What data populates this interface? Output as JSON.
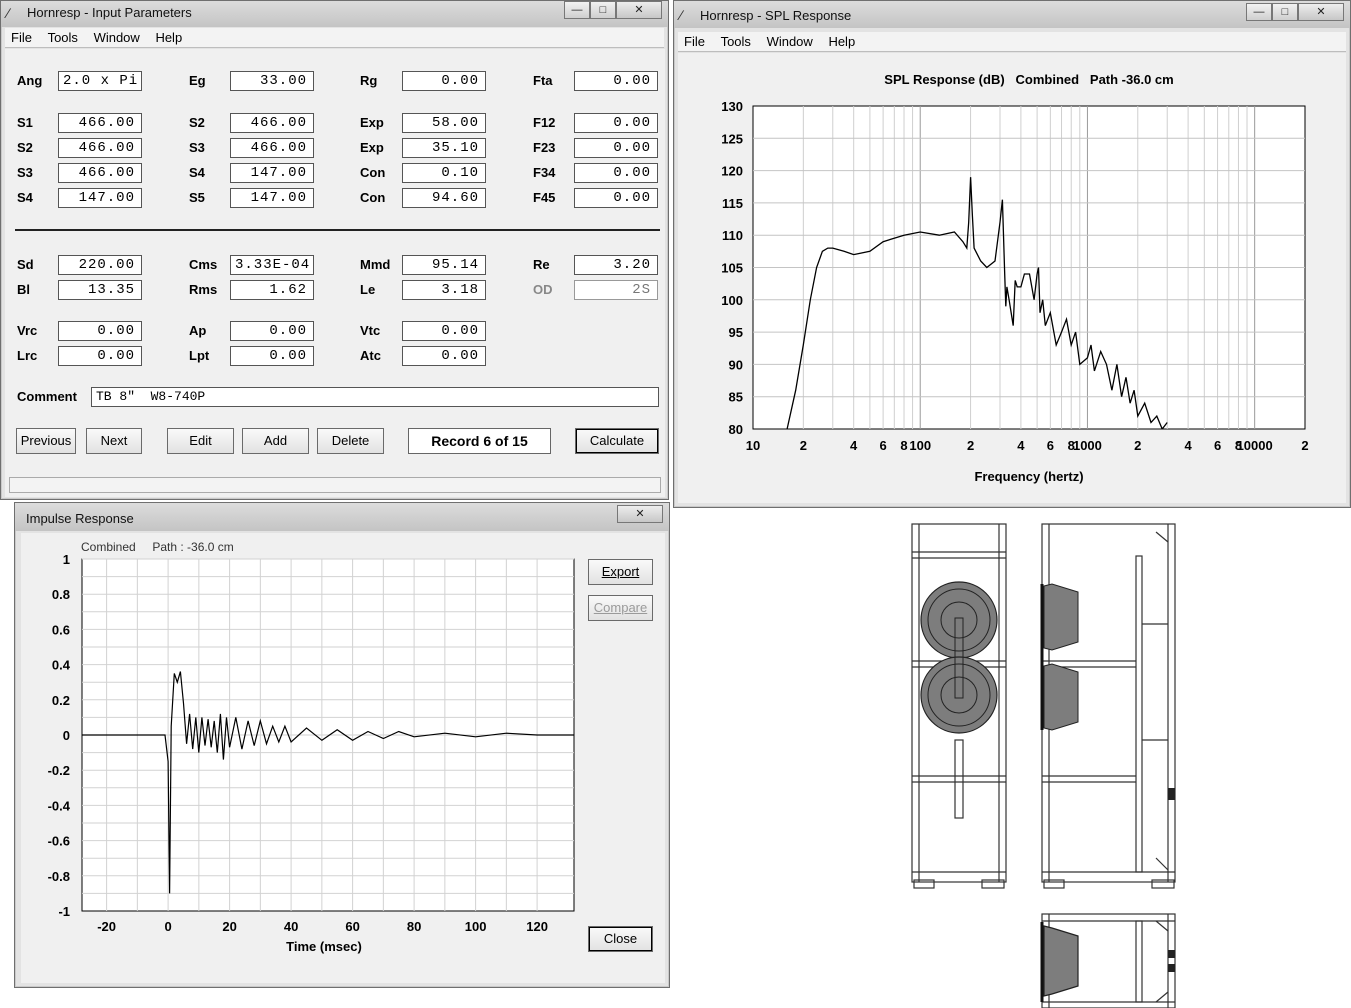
{
  "input_window": {
    "title": "Hornresp - Input Parameters",
    "menu": [
      "File",
      "Tools",
      "Window",
      "Help"
    ],
    "rows": [
      [
        {
          "label": "Ang",
          "value": "2.0 x Pi",
          "align": "left"
        },
        {
          "label": "Eg",
          "value": "33.00"
        },
        {
          "label": "Rg",
          "value": "0.00"
        },
        {
          "label": "Fta",
          "value": "0.00"
        }
      ],
      [
        {
          "label": "S1",
          "value": "466.00"
        },
        {
          "label": "S2",
          "value": "466.00"
        },
        {
          "label": "Exp",
          "value": "58.00"
        },
        {
          "label": "F12",
          "value": "0.00"
        }
      ],
      [
        {
          "label": "S2",
          "value": "466.00"
        },
        {
          "label": "S3",
          "value": "466.00"
        },
        {
          "label": "Exp",
          "value": "35.10"
        },
        {
          "label": "F23",
          "value": "0.00"
        }
      ],
      [
        {
          "label": "S3",
          "value": "466.00"
        },
        {
          "label": "S4",
          "value": "147.00"
        },
        {
          "label": "Con",
          "value": "0.10"
        },
        {
          "label": "F34",
          "value": "0.00"
        }
      ],
      [
        {
          "label": "S4",
          "value": "147.00"
        },
        {
          "label": "S5",
          "value": "147.00"
        },
        {
          "label": "Con",
          "value": "94.60"
        },
        {
          "label": "F45",
          "value": "0.00"
        }
      ],
      [
        {
          "label": "Sd",
          "value": "220.00"
        },
        {
          "label": "Cms",
          "value": "3.33E-04",
          "align": "left"
        },
        {
          "label": "Mmd",
          "value": "95.14"
        },
        {
          "label": "Re",
          "value": "3.20"
        }
      ],
      [
        {
          "label": "Bl",
          "value": "13.35"
        },
        {
          "label": "Rms",
          "value": "1.62"
        },
        {
          "label": "Le",
          "value": "3.18"
        },
        {
          "label": "OD",
          "value": "2S",
          "disabled": true
        }
      ],
      [
        {
          "label": "Vrc",
          "value": "0.00"
        },
        {
          "label": "Ap",
          "value": "0.00"
        },
        {
          "label": "Vtc",
          "value": "0.00"
        }
      ],
      [
        {
          "label": "Lrc",
          "value": "0.00"
        },
        {
          "label": "Lpt",
          "value": "0.00"
        },
        {
          "label": "Atc",
          "value": "0.00"
        }
      ]
    ],
    "comment_label": "Comment",
    "comment_value": "TB 8\"  W8-740P",
    "buttons": {
      "previous": "Previous",
      "next": "Next",
      "edit": "Edit",
      "add": "Add",
      "delete": "Delete",
      "calculate": "Calculate"
    },
    "record": "Record 6 of 15"
  },
  "spl_window": {
    "title": "Hornresp - SPL Response",
    "menu": [
      "File",
      "Tools",
      "Window",
      "Help"
    ],
    "plot_title": "SPL Response (dB)   Combined   Path -36.0 cm",
    "xlabel": "Frequency (hertz)",
    "ytick_labels": [
      "130",
      "125",
      "120",
      "115",
      "110",
      "105",
      "100",
      "95",
      "90",
      "85",
      "80"
    ],
    "xtick_labels": [
      [
        "10",
        10
      ],
      [
        "2",
        20
      ],
      [
        "4",
        40
      ],
      [
        "6",
        60
      ],
      [
        "8",
        80
      ],
      [
        "100",
        100
      ],
      [
        "2",
        200
      ],
      [
        "4",
        400
      ],
      [
        "6",
        600
      ],
      [
        "8",
        800
      ],
      [
        "1000",
        1000
      ],
      [
        "2",
        2000
      ],
      [
        "4",
        4000
      ],
      [
        "6",
        6000
      ],
      [
        "8",
        8000
      ],
      [
        "10000",
        10000
      ],
      [
        "2",
        20000
      ]
    ]
  },
  "impulse_window": {
    "title": "Impulse Response",
    "subtitle": "Combined     Path : -36.0 cm",
    "xlabel": "Time (msec)",
    "buttons": {
      "export": "Export",
      "compare": "Compare",
      "close": "Close"
    },
    "ytick_labels": [
      "1",
      "0.8",
      "0.6",
      "0.4",
      "0.2",
      "0",
      "-0.2",
      "-0.4",
      "-0.6",
      "-0.8",
      "-1"
    ],
    "xtick_labels": [
      "-20",
      "0",
      "20",
      "40",
      "60",
      "80",
      "100",
      "120"
    ]
  },
  "chart_data": [
    {
      "type": "line",
      "title": "SPL Response (dB)   Combined   Path -36.0 cm",
      "xlabel": "Frequency (hertz)",
      "ylabel": "",
      "xscale": "log",
      "xlim": [
        10,
        20000
      ],
      "ylim": [
        80,
        130
      ],
      "grid": true,
      "series": [
        {
          "x": [
            16,
            18,
            20,
            22,
            24,
            26,
            28,
            30,
            35,
            40,
            50,
            60,
            80,
            100,
            130,
            160,
            180,
            190,
            195,
            200,
            205,
            210,
            230,
            250,
            280,
            300,
            310,
            315,
            320,
            325,
            330,
            340,
            360,
            370,
            380,
            400,
            420,
            450,
            480,
            500,
            510,
            520,
            540,
            560,
            600,
            650,
            700,
            750,
            800,
            850,
            900,
            1000,
            1050,
            1100,
            1200,
            1300,
            1400,
            1500,
            1600,
            1700,
            1800,
            1900,
            2000,
            2200,
            2400,
            2600,
            2800,
            3000
          ],
          "y": [
            80,
            86,
            93,
            100,
            105,
            107.5,
            108,
            108,
            107.5,
            107,
            107.5,
            109,
            110,
            110.5,
            110,
            110.5,
            109,
            108,
            112,
            119,
            113,
            108,
            106,
            105,
            106,
            112,
            115.5,
            110,
            104,
            99,
            102,
            100,
            96,
            103,
            102,
            102,
            104,
            104,
            100,
            104,
            105,
            98,
            100,
            96,
            98,
            93,
            95,
            97,
            93,
            95,
            90,
            91,
            93,
            89,
            92,
            90,
            86,
            90,
            85,
            88,
            84,
            86,
            82,
            84,
            81,
            82,
            80,
            81
          ]
        }
      ]
    },
    {
      "type": "line",
      "title": "Combined     Path : -36.0 cm",
      "xlabel": "Time (msec)",
      "ylabel": "",
      "xlim": [
        -28,
        132
      ],
      "ylim": [
        -1,
        1
      ],
      "grid": true,
      "series": [
        {
          "x": [
            -28,
            -1,
            0,
            0.5,
            1,
            2,
            3,
            4,
            5,
            6,
            7,
            8,
            9,
            10,
            11,
            12,
            13,
            14,
            15,
            16,
            17,
            18,
            19,
            20,
            22,
            24,
            26,
            28,
            30,
            32,
            34,
            36,
            38,
            40,
            45,
            50,
            55,
            60,
            65,
            70,
            75,
            80,
            90,
            100,
            110,
            120,
            132
          ],
          "y": [
            0,
            0,
            -0.15,
            -0.9,
            0.05,
            0.35,
            0.3,
            0.36,
            0.18,
            -0.05,
            0.12,
            -0.08,
            0.1,
            -0.1,
            0.1,
            -0.06,
            0.09,
            -0.07,
            0.08,
            -0.1,
            0.12,
            -0.14,
            0.1,
            -0.07,
            0.1,
            -0.08,
            0.08,
            -0.06,
            0.08,
            -0.05,
            0.05,
            -0.04,
            0.05,
            -0.04,
            0.04,
            -0.03,
            0.03,
            -0.03,
            0.02,
            -0.02,
            0.02,
            -0.01,
            0.01,
            -0.01,
            0.01,
            0,
            0
          ]
        }
      ]
    }
  ]
}
